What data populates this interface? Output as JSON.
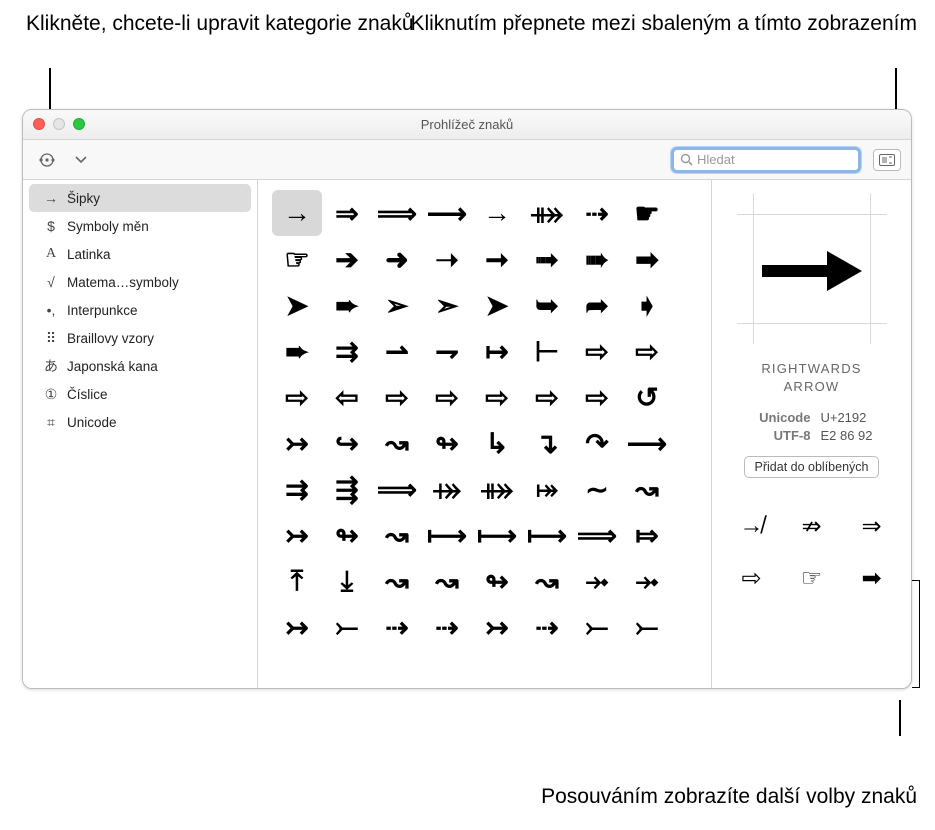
{
  "callouts": {
    "topLeft": "Klikněte, chcete-li upravit kategorie znaků",
    "topRight": "Kliknutím přepnete mezi sbaleným a tímto zobrazením",
    "bottomRight": "Posouváním zobrazíte další volby znaků"
  },
  "window": {
    "title": "Prohlížeč znaků"
  },
  "search": {
    "placeholder": "Hledat"
  },
  "sidebar": [
    {
      "icon": "→",
      "label": "Šipky",
      "selected": true
    },
    {
      "icon": "$",
      "label": "Symboly měn"
    },
    {
      "icon": "A",
      "label": "Latinka",
      "serif": true
    },
    {
      "icon": "√",
      "label": "Matema…symboly"
    },
    {
      "icon": "•,",
      "label": "Interpunkce"
    },
    {
      "icon": "⠿",
      "label": "Braillovy vzory"
    },
    {
      "icon": "あ",
      "label": "Japonská kana"
    },
    {
      "icon": "①",
      "label": "Číslice"
    },
    {
      "icon": "⌗",
      "label": "Unicode"
    }
  ],
  "grid": [
    [
      "→",
      "⇒",
      "⟹",
      "⟶",
      "→",
      "⤁",
      "⇢",
      "☛"
    ],
    [
      "☞",
      "➔",
      "➜",
      "➝",
      "➞",
      "➟",
      "➠",
      "➡"
    ],
    [
      "➤",
      "➨",
      "➢",
      "➣",
      "➤",
      "➥",
      "➦",
      "➧"
    ],
    [
      "➨",
      "⇉",
      "⇀",
      "⇁",
      "↦",
      "⊢",
      "⇨",
      "⇨"
    ],
    [
      "⇨",
      "⇦",
      "⇨",
      "⇨",
      "⇨",
      "⇨",
      "⇨",
      "↺"
    ],
    [
      "↣",
      "↪",
      "↝",
      "↬",
      "↳",
      "↴",
      "↷",
      "⟶"
    ],
    [
      "⇉",
      "⇶",
      "⟹",
      "⤀",
      "⤁",
      "⤅",
      "∼",
      "↝"
    ],
    [
      "↣",
      "↬",
      "↝",
      "⟼",
      "⟼",
      "⟼",
      "⟹",
      "⤇"
    ],
    [
      "⤒",
      "⤓",
      "↝",
      "↝",
      "↬",
      "↝",
      "⤞",
      "⤞"
    ],
    [
      "↣",
      "⤚",
      "⇢",
      "⇢",
      "↣",
      "⇢",
      "⤚",
      "⤚"
    ]
  ],
  "detail": {
    "bigChar": "→",
    "name1": "RIGHTWARDS",
    "name2": "ARROW",
    "unicodeLabel": "Unicode",
    "unicodeVal": "U+2192",
    "utf8Label": "UTF-8",
    "utf8Val": "E2 86 92",
    "favBtn": "Přidat do oblíbených",
    "variants": [
      "↛",
      "⇏",
      "⇒",
      "⇨",
      "☞",
      "➡"
    ]
  }
}
